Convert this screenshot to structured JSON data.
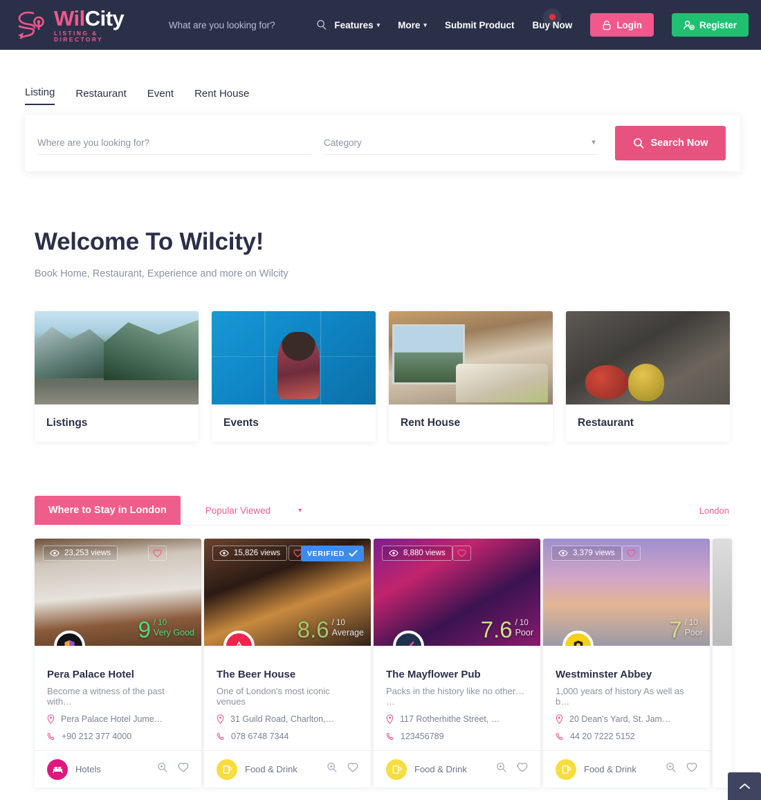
{
  "header": {
    "logo_name_part1": "Wil",
    "logo_name_part2": "City",
    "logo_tagline": "LISTING & DIRECTORY",
    "search_placeholder": "What are you looking for?",
    "search_value": "",
    "nav": [
      {
        "label": "Features",
        "has_caret": true
      },
      {
        "label": "More",
        "has_caret": true
      },
      {
        "label": "Submit Product",
        "has_caret": false
      },
      {
        "label": "Buy Now",
        "has_caret": false
      }
    ],
    "login_label": "Login",
    "register_label": "Register",
    "colors": {
      "bar": "#2b3049",
      "pink": "#f2588c",
      "green": "#1fc071",
      "dot": "#ee2d3c"
    }
  },
  "search_tabs": [
    {
      "label": "Listing",
      "active": true
    },
    {
      "label": "Restaurant",
      "active": false
    },
    {
      "label": "Event",
      "active": false
    },
    {
      "label": "Rent House",
      "active": false
    }
  ],
  "search_panel": {
    "where_placeholder": "Where are you looking for?",
    "where_value": "",
    "category_placeholder": "Category",
    "category_value": "",
    "search_button": "Search Now"
  },
  "welcome": {
    "title": "Welcome To Wilcity!",
    "subtitle": "Book Home, Restaurant, Experience and more on Wilcity"
  },
  "categories": [
    {
      "name": "Listings",
      "image": "lake-pier-mountains"
    },
    {
      "name": "Events",
      "image": "woman-dancing-blue-wall"
    },
    {
      "name": "Rent House",
      "image": "bedroom-with-mountain-view"
    },
    {
      "name": "Restaurant",
      "image": "still-life-fruit-bottles"
    }
  ],
  "listing_section": {
    "pill_tab": "Where to Stay in London",
    "sort_label": "Popular Viewed",
    "city_label": "London",
    "cards": [
      {
        "views": "23,253 views",
        "verified": false,
        "score": "9",
        "out_of": "/ 10",
        "score_word": "Very Good",
        "score_color": "#4ade80",
        "title": "Pera Palace Hotel",
        "description": "Become a witness of the past with…",
        "address": "Pera Palace Hotel Jume…",
        "phone": "+90 212 377 4000",
        "category": "Hotels",
        "category_color": "#e0177f",
        "category_icon": "bed-icon",
        "avatar_color": "#141117",
        "avatar_icon": "shield-icon",
        "media": "m-pera"
      },
      {
        "views": "15,826 views",
        "verified": true,
        "verified_label": "VERIFIED",
        "score": "8.6",
        "out_of": "/ 10",
        "score_word": "Average",
        "score_color": "#9ccb6a",
        "title": "The Beer House",
        "description": "One of London's most iconic venues",
        "address": "31 Guild Road, Charlton,…",
        "phone": "078 6748 7344",
        "category": "Food & Drink",
        "category_color": "#f7dd3e",
        "category_icon": "beer-mug-icon",
        "avatar_color": "#f0254c",
        "avatar_icon": "triangle-a-icon",
        "media": "m-beer"
      },
      {
        "views": "8,880 views",
        "verified": false,
        "score": "7.6",
        "out_of": "/ 10",
        "score_word": "Poor",
        "score_color": "#cfe08a",
        "title": "The Mayflower Pub",
        "description": "Packs in the history like no other… …",
        "address": "117 Rotherhithe Street, …",
        "phone": "123456789",
        "category": "Food & Drink",
        "category_color": "#f7dd3e",
        "category_icon": "beer-mug-icon",
        "avatar_color": "#23304c",
        "avatar_icon": "check-icon",
        "media": "m-may"
      },
      {
        "views": "3,379 views",
        "verified": false,
        "score": "7",
        "out_of": "/ 10",
        "score_word": "Poor",
        "score_color": "#cfe08a",
        "title": "Westminster Abbey",
        "description": "1,000 years of history As well as b…",
        "address": "20 Dean's Yard, St. Jam…",
        "phone": "44 20 7222 5152",
        "category": "Food & Drink",
        "category_color": "#f7dd3e",
        "category_icon": "beer-mug-icon",
        "avatar_color": "#f5d117",
        "avatar_icon": "lion-crest-icon",
        "media": "m-abbey"
      }
    ]
  }
}
